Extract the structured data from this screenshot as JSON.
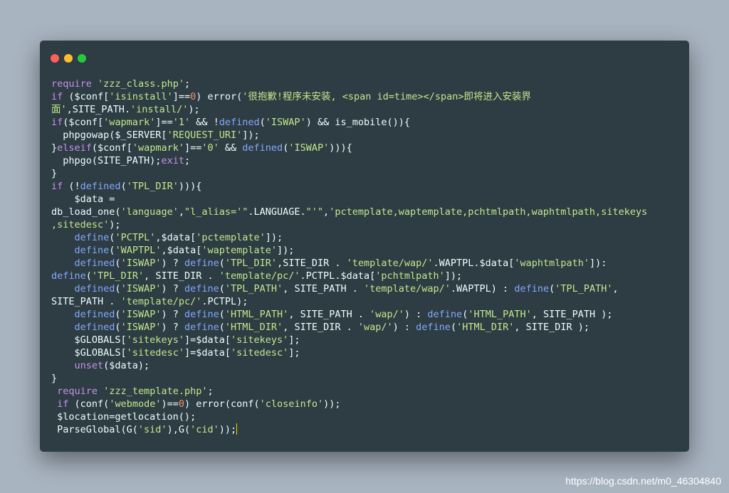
{
  "window": {
    "buttons": [
      {
        "name": "close",
        "color": "#ff5f56"
      },
      {
        "name": "minimize",
        "color": "#ffbd2e"
      },
      {
        "name": "maximize",
        "color": "#27c93f"
      }
    ]
  },
  "colors": {
    "background": "#a9b4c1",
    "editor": "#2e3c43",
    "keyword": "#c792ea",
    "string": "#c3e88d",
    "function": "#82aaff",
    "number": "#f78c6c",
    "plain": "#eeffff"
  },
  "code": {
    "lines": [
      [
        [
          "kw",
          "require"
        ],
        [
          "pl",
          " "
        ],
        [
          "st",
          "'zzz_class.php'"
        ],
        [
          "pl",
          ";"
        ]
      ],
      [
        [
          "kw",
          "if"
        ],
        [
          "pl",
          " ($conf["
        ],
        [
          "st",
          "'isinstall'"
        ],
        [
          "pl",
          "]=="
        ],
        [
          "nm",
          "0"
        ],
        [
          "pl",
          ") error("
        ],
        [
          "st",
          "'很抱歉!程序未安装, <span id=time></span>即将进入安装界"
        ]
      ],
      [
        [
          "st",
          "面'"
        ],
        [
          "pl",
          ",SITE_PATH."
        ],
        [
          "st",
          "'install/'"
        ],
        [
          "pl",
          ");"
        ]
      ],
      [
        [
          "kw",
          "if"
        ],
        [
          "pl",
          "($conf["
        ],
        [
          "st",
          "'wapmark'"
        ],
        [
          "pl",
          "]=="
        ],
        [
          "st",
          "'1'"
        ],
        [
          "pl",
          " && !"
        ],
        [
          "fn",
          "defined"
        ],
        [
          "pl",
          "("
        ],
        [
          "st",
          "'ISWAP'"
        ],
        [
          "pl",
          ") && is_mobile()){"
        ]
      ],
      [
        [
          "pl",
          "  phpgowap($_SERVER["
        ],
        [
          "st",
          "'REQUEST_URI'"
        ],
        [
          "pl",
          "]);"
        ]
      ],
      [
        [
          "pl",
          "}"
        ],
        [
          "kw",
          "elseif"
        ],
        [
          "pl",
          "($conf["
        ],
        [
          "st",
          "'wapmark'"
        ],
        [
          "pl",
          "]=="
        ],
        [
          "st",
          "'0'"
        ],
        [
          "pl",
          " && "
        ],
        [
          "fn",
          "defined"
        ],
        [
          "pl",
          "("
        ],
        [
          "st",
          "'ISWAP'"
        ],
        [
          "pl",
          "))){"
        ]
      ],
      [
        [
          "pl",
          "  phpgo(SITE_PATH);"
        ],
        [
          "kw",
          "exit"
        ],
        [
          "pl",
          ";"
        ]
      ],
      [
        [
          "pl",
          "}"
        ]
      ],
      [
        [
          "kw",
          "if"
        ],
        [
          "pl",
          " (!"
        ],
        [
          "fn",
          "defined"
        ],
        [
          "pl",
          "("
        ],
        [
          "st",
          "'TPL_DIR'"
        ],
        [
          "pl",
          "))){"
        ]
      ],
      [
        [
          "pl",
          "    $data ="
        ]
      ],
      [
        [
          "pl",
          "db_load_one("
        ],
        [
          "st",
          "'language'"
        ],
        [
          "pl",
          ","
        ],
        [
          "st",
          "\"l_alias='\""
        ],
        [
          "pl",
          ".LANGUAGE."
        ],
        [
          "st",
          "\"'\""
        ],
        [
          "pl",
          ","
        ],
        [
          "st",
          "'pctemplate,waptemplate,pchtmlpath,waphtmlpath,sitekeys"
        ]
      ],
      [
        [
          "st",
          ",sitedesc'"
        ],
        [
          "pl",
          ");"
        ]
      ],
      [
        [
          "pl",
          "    "
        ],
        [
          "fn",
          "define"
        ],
        [
          "pl",
          "("
        ],
        [
          "st",
          "'PCTPL'"
        ],
        [
          "pl",
          ",$data["
        ],
        [
          "st",
          "'pctemplate'"
        ],
        [
          "pl",
          "]);"
        ]
      ],
      [
        [
          "pl",
          "    "
        ],
        [
          "fn",
          "define"
        ],
        [
          "pl",
          "("
        ],
        [
          "st",
          "'WAPTPL'"
        ],
        [
          "pl",
          ",$data["
        ],
        [
          "st",
          "'waptemplate'"
        ],
        [
          "pl",
          "]);"
        ]
      ],
      [
        [
          "pl",
          "    "
        ],
        [
          "fn",
          "defined"
        ],
        [
          "pl",
          "("
        ],
        [
          "st",
          "'ISWAP'"
        ],
        [
          "pl",
          ") ? "
        ],
        [
          "fn",
          "define"
        ],
        [
          "pl",
          "("
        ],
        [
          "st",
          "'TPL_DIR'"
        ],
        [
          "pl",
          ",SITE_DIR . "
        ],
        [
          "st",
          "'template/wap/'"
        ],
        [
          "pl",
          ".WAPTPL.$data["
        ],
        [
          "st",
          "'waphtmlpath'"
        ],
        [
          "pl",
          "]):"
        ]
      ],
      [
        [
          "fn",
          "define"
        ],
        [
          "pl",
          "("
        ],
        [
          "st",
          "'TPL_DIR'"
        ],
        [
          "pl",
          ", SITE_DIR . "
        ],
        [
          "st",
          "'template/pc/'"
        ],
        [
          "pl",
          ".PCTPL.$data["
        ],
        [
          "st",
          "'pchtmlpath'"
        ],
        [
          "pl",
          "]);"
        ]
      ],
      [
        [
          "pl",
          "    "
        ],
        [
          "fn",
          "defined"
        ],
        [
          "pl",
          "("
        ],
        [
          "st",
          "'ISWAP'"
        ],
        [
          "pl",
          ") ? "
        ],
        [
          "fn",
          "define"
        ],
        [
          "pl",
          "("
        ],
        [
          "st",
          "'TPL_PATH'"
        ],
        [
          "pl",
          ", SITE_PATH . "
        ],
        [
          "st",
          "'template/wap/'"
        ],
        [
          "pl",
          ".WAPTPL) : "
        ],
        [
          "fn",
          "define"
        ],
        [
          "pl",
          "("
        ],
        [
          "st",
          "'TPL_PATH'"
        ],
        [
          "pl",
          ","
        ]
      ],
      [
        [
          "pl",
          "SITE_PATH . "
        ],
        [
          "st",
          "'template/pc/'"
        ],
        [
          "pl",
          ".PCTPL);"
        ]
      ],
      [
        [
          "pl",
          "    "
        ],
        [
          "fn",
          "defined"
        ],
        [
          "pl",
          "("
        ],
        [
          "st",
          "'ISWAP'"
        ],
        [
          "pl",
          ") ? "
        ],
        [
          "fn",
          "define"
        ],
        [
          "pl",
          "("
        ],
        [
          "st",
          "'HTML_PATH'"
        ],
        [
          "pl",
          ", SITE_PATH . "
        ],
        [
          "st",
          "'wap/'"
        ],
        [
          "pl",
          ") : "
        ],
        [
          "fn",
          "define"
        ],
        [
          "pl",
          "("
        ],
        [
          "st",
          "'HTML_PATH'"
        ],
        [
          "pl",
          ", SITE_PATH );"
        ]
      ],
      [
        [
          "pl",
          "    "
        ],
        [
          "fn",
          "defined"
        ],
        [
          "pl",
          "("
        ],
        [
          "st",
          "'ISWAP'"
        ],
        [
          "pl",
          ") ? "
        ],
        [
          "fn",
          "define"
        ],
        [
          "pl",
          "("
        ],
        [
          "st",
          "'HTML_DIR'"
        ],
        [
          "pl",
          ", SITE_DIR . "
        ],
        [
          "st",
          "'wap/'"
        ],
        [
          "pl",
          ") : "
        ],
        [
          "fn",
          "define"
        ],
        [
          "pl",
          "("
        ],
        [
          "st",
          "'HTML_DIR'"
        ],
        [
          "pl",
          ", SITE_DIR );"
        ]
      ],
      [
        [
          "pl",
          "    $GLOBALS["
        ],
        [
          "st",
          "'sitekeys'"
        ],
        [
          "pl",
          "]=$data["
        ],
        [
          "st",
          "'sitekeys'"
        ],
        [
          "pl",
          "];"
        ]
      ],
      [
        [
          "pl",
          "    $GLOBALS["
        ],
        [
          "st",
          "'sitedesc'"
        ],
        [
          "pl",
          "]=$data["
        ],
        [
          "st",
          "'sitedesc'"
        ],
        [
          "pl",
          "];"
        ]
      ],
      [
        [
          "pl",
          "    "
        ],
        [
          "kw",
          "unset"
        ],
        [
          "pl",
          "($data);"
        ]
      ],
      [
        [
          "pl",
          "}"
        ]
      ],
      [
        [
          "pl",
          " "
        ],
        [
          "kw",
          "require"
        ],
        [
          "pl",
          " "
        ],
        [
          "st",
          "'zzz_template.php'"
        ],
        [
          "pl",
          ";"
        ]
      ],
      [
        [
          "pl",
          " "
        ],
        [
          "kw",
          "if"
        ],
        [
          "pl",
          " (conf("
        ],
        [
          "st",
          "'webmode'"
        ],
        [
          "pl",
          ")=="
        ],
        [
          "nm",
          "0"
        ],
        [
          "pl",
          ") error(conf("
        ],
        [
          "st",
          "'closeinfo'"
        ],
        [
          "pl",
          "));"
        ]
      ],
      [
        [
          "pl",
          " $location=getlocation();"
        ]
      ],
      [
        [
          "pl",
          " ParseGlobal(G("
        ],
        [
          "st",
          "'sid'"
        ],
        [
          "pl",
          "),G("
        ],
        [
          "st",
          "'cid'"
        ],
        [
          "pl",
          "));"
        ]
      ]
    ]
  },
  "watermark": "https://blog.csdn.net/m0_46304840"
}
